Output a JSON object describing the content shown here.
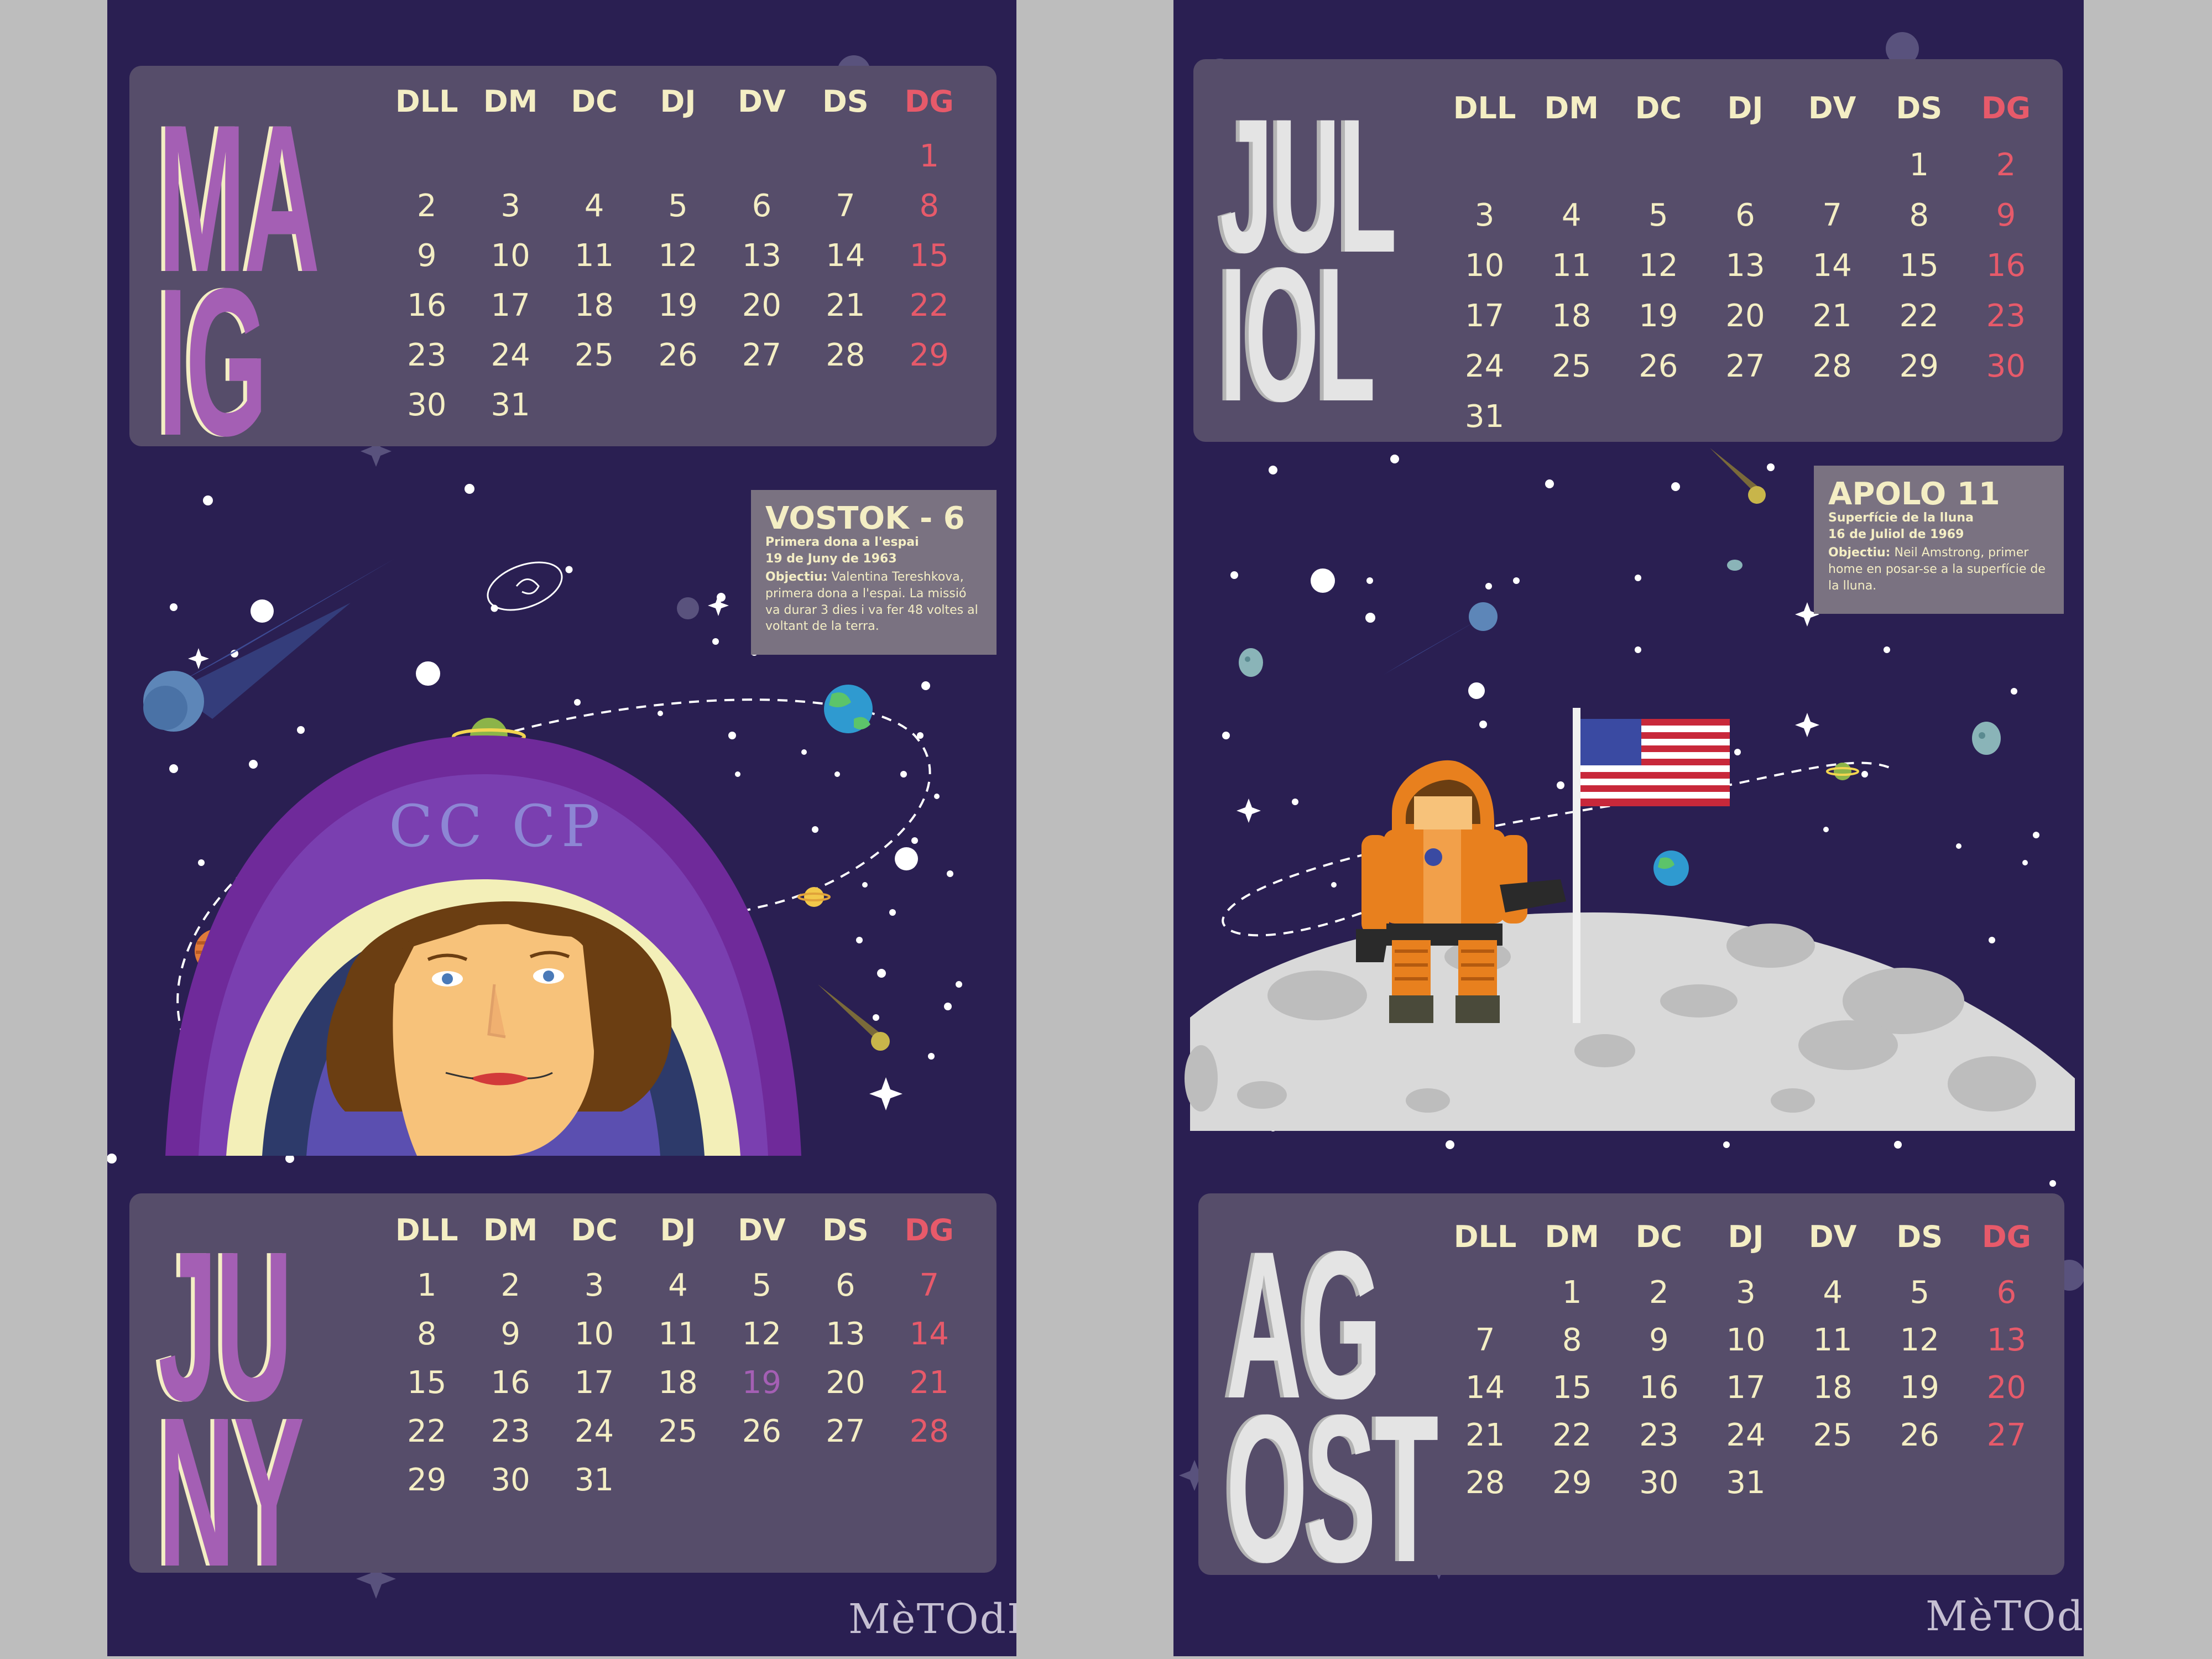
{
  "weekdays": [
    "DLL",
    "DM",
    "DC",
    "DJ",
    "DV",
    "DS",
    "DG"
  ],
  "sheets": {
    "left": {
      "top_month": {
        "title_lines": [
          "MA",
          "IG"
        ],
        "rows": [
          [
            "",
            "",
            "",
            "",
            "",
            "",
            "1"
          ],
          [
            "2",
            "3",
            "4",
            "5",
            "6",
            "7",
            "8"
          ],
          [
            "9",
            "10",
            "11",
            "12",
            "13",
            "14",
            "15"
          ],
          [
            "16",
            "17",
            "18",
            "19",
            "20",
            "21",
            "22"
          ],
          [
            "23",
            "24",
            "25",
            "26",
            "27",
            "28",
            "29"
          ],
          [
            "30",
            "31",
            "",
            "",
            "",
            "",
            ""
          ]
        ]
      },
      "info": {
        "title": "VOSTOK - 6",
        "line1": "Primera dona a l'espai",
        "line2": "19 de Juny de 1963",
        "objective_label": "Objectiu:",
        "objective_text": "Valentina Tereshkova, primera dona a l'espai. La missió va durar 3 dies i va fer 48 voltes al voltant de la terra."
      },
      "helmet_text": "CC CP",
      "bottom_month": {
        "title_lines": [
          "JU",
          "NY"
        ],
        "rows": [
          [
            "1",
            "2",
            "3",
            "4",
            "5",
            "6",
            "7"
          ],
          [
            "8",
            "9",
            "10",
            "11",
            "12",
            "13",
            "14"
          ],
          [
            "15",
            "16",
            "17",
            "18",
            "19",
            "20",
            "21"
          ],
          [
            "22",
            "23",
            "24",
            "25",
            "26",
            "27",
            "28"
          ],
          [
            "29",
            "30",
            "31",
            "",
            "",
            "",
            ""
          ]
        ],
        "highlight_day": "19"
      },
      "logo": "MèTOdE"
    },
    "right": {
      "top_month": {
        "title_lines": [
          "JUL",
          "IOL"
        ],
        "rows": [
          [
            "",
            "",
            "",
            "",
            "",
            "1",
            "2"
          ],
          [
            "3",
            "4",
            "5",
            "6",
            "7",
            "8",
            "9"
          ],
          [
            "10",
            "11",
            "12",
            "13",
            "14",
            "15",
            "16"
          ],
          [
            "17",
            "18",
            "19",
            "20",
            "21",
            "22",
            "23"
          ],
          [
            "24",
            "25",
            "26",
            "27",
            "28",
            "29",
            "30"
          ],
          [
            "31",
            "",
            "",
            "",
            "",
            "",
            ""
          ]
        ]
      },
      "info": {
        "title": "APOLO 11",
        "line1": "Superfície de la lluna",
        "line2": "16 de Juliol de 1969",
        "objective_label": "Objectiu:",
        "objective_text": "Neil Amstrong, primer home en posar-se a la superfície de la lluna."
      },
      "bottom_month": {
        "title_lines": [
          "AG",
          "OST"
        ],
        "rows": [
          [
            "",
            "1",
            "2",
            "3",
            "4",
            "5",
            "6"
          ],
          [
            "7",
            "8",
            "9",
            "10",
            "11",
            "12",
            "13"
          ],
          [
            "14",
            "15",
            "16",
            "17",
            "18",
            "19",
            "20"
          ],
          [
            "21",
            "22",
            "23",
            "24",
            "25",
            "26",
            "27"
          ],
          [
            "28",
            "29",
            "30",
            "31",
            "",
            "",
            ""
          ]
        ]
      },
      "logo": "MèTOdE"
    }
  },
  "colors": {
    "sheet_background": "#2a1f52",
    "panel": "#564d6a",
    "day_text": "#f4eec4",
    "sunday": "#e75a6a",
    "highlight": "#a45fb4",
    "month_purple": "#a45fb4",
    "month_white": "#e4e4e4",
    "page_background": "#bdbdbd"
  }
}
